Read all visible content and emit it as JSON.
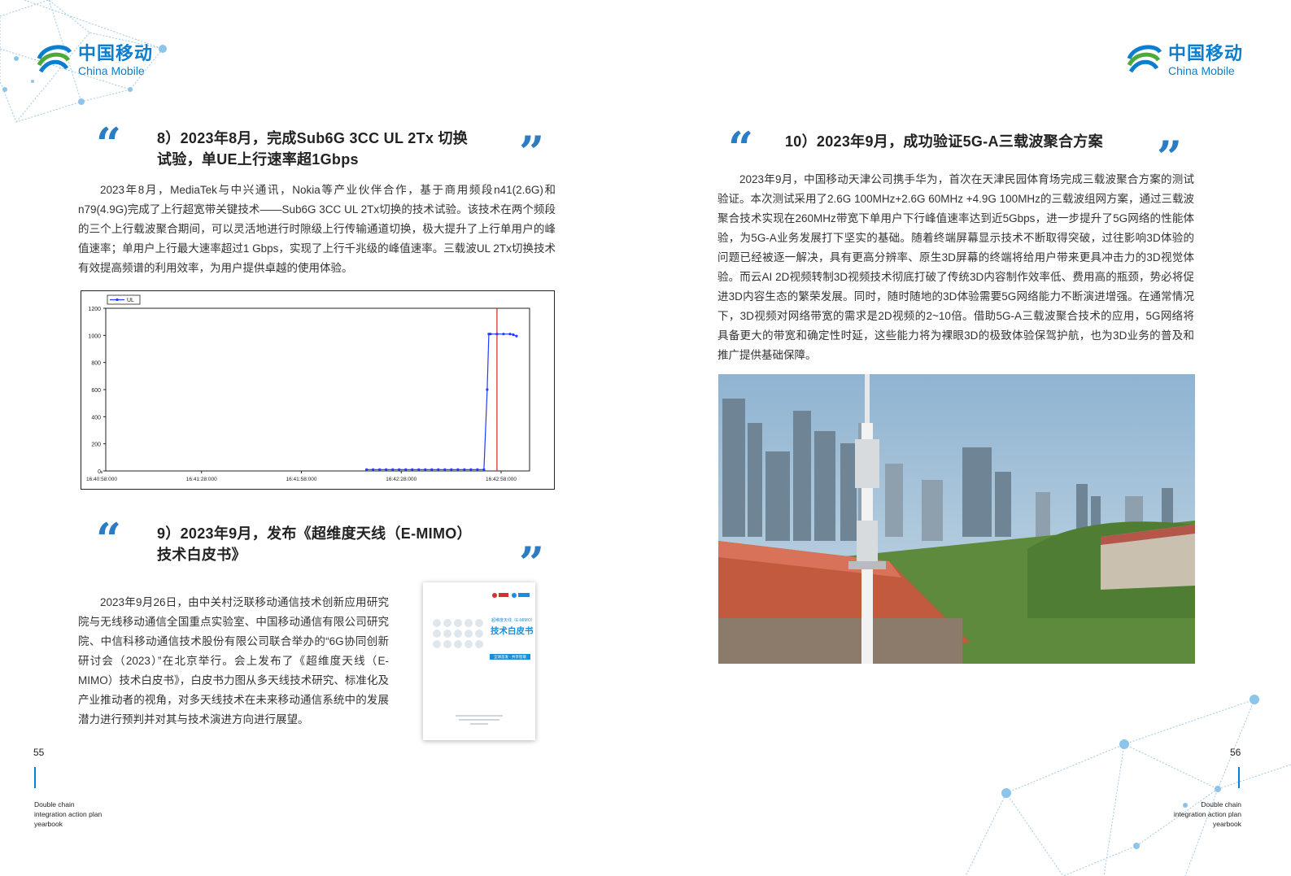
{
  "brand": {
    "name_cn": "中国移动",
    "name_en": "China Mobile"
  },
  "left": {
    "section8": {
      "quote_open": "“",
      "quote_close": "”",
      "title_line1": "8）2023年8月，完成Sub6G 3CC UL 2Tx 切换",
      "title_line2": "试验，单UE上行速率超1Gbps",
      "body": "2023年8月，MediaTek与中兴通讯，Nokia等产业伙伴合作，基于商用频段n41(2.6G)和n79(4.9G)完成了上行超宽带关键技术——Sub6G 3CC UL 2Tx切换的技术试验。该技术在两个频段的三个上行载波聚合期间，可以灵活地进行时隙级上行传输通道切换，极大提升了上行单用户的峰值速率；单用户上行最大速率超过1 Gbps，实现了上行千兆级的峰值速率。三载波UL 2Tx切换技术有效提高频谱的利用效率，为用户提供卓越的使用体验。"
    },
    "section9": {
      "quote_open": "“",
      "quote_close": "”",
      "title_line1": "9）2023年9月，发布《超维度天线（E-MIMO）",
      "title_line2": "技术白皮书》",
      "body": "2023年9月26日，由中关村泛联移动通信技术创新应用研究院与无线移动通信全国重点实验室、中国移动通信有限公司研究院、中信科移动通信技术股份有限公司联合举办的“6G协同创新研讨会（2023）”在北京举行。会上发布了《超维度天线（E-MIMO）技术白皮书》，白皮书力图从多天线技术研究、标准化及产业推动者的视角，对多天线技术在未来移动通信系统中的发展潜力进行预判并对其与技术演进方向进行展望。"
    },
    "cover": {
      "title_small": "超维度天线（E-MIMO）",
      "title_big": "技术白皮书",
      "badge": "全球首发 · 共享智联"
    },
    "page_number": "55",
    "footer": [
      "Double chain",
      "integration action plan",
      "yearbook"
    ]
  },
  "right": {
    "section10": {
      "quote_open": "“",
      "quote_close": "”",
      "title": "10）2023年9月，成功验证5G-A三载波聚合方案",
      "body": "2023年9月，中国移动天津公司携手华为，首次在天津民园体育场完成三载波聚合方案的测试验证。本次测试采用了2.6G 100MHz+2.6G 60MHz +4.9G 100MHz的三载波组网方案，通过三载波聚合技术实现在260MHz带宽下单用户下行峰值速率达到近5Gbps，进一步提升了5G网络的性能体验，为5G-A业务发展打下坚实的基础。随着终端屏幕显示技术不断取得突破，过往影响3D体验的问题已经被逐一解决，具有更高分辨率、原生3D屏幕的终端将给用户带来更具冲击力的3D视觉体验。而云AI 2D视频转制3D视频技术彻底打破了传统3D内容制作效率低、费用高的瓶颈，势必将促进3D内容生态的繁荣发展。同时，随时随地的3D体验需要5G网络能力不断演进增强。在通常情况下，3D视频对网络带宽的需求是2D视频的2~10倍。借助5G-A三载波聚合技术的应用，5G网络将具备更大的带宽和确定性时延，这些能力将为裸眼3D的极致体验保驾护航，也为3D业务的普及和推广提供基础保障。"
    },
    "page_number": "56",
    "footer": [
      "Double chain",
      "integration action plan",
      "yearbook"
    ]
  },
  "chart_data": {
    "type": "line",
    "title": "",
    "legend": [
      "UL"
    ],
    "legend_position": "top-left",
    "ylim": [
      0,
      1200
    ],
    "yticks": [
      "0",
      "200",
      "400",
      "600",
      "800",
      "1000",
      "1200"
    ],
    "xticks": [
      "16:40:58:000",
      "16:41:28:000",
      "16:41:58:000",
      "16:42:28:000",
      "16:42:58:000"
    ],
    "xlim": [
      0,
      130
    ],
    "series": [
      {
        "name": "UL",
        "x": [
          80,
          82,
          84,
          86,
          88,
          90,
          92,
          94,
          96,
          98,
          100,
          102,
          104,
          106,
          108,
          110,
          112,
          114,
          116,
          117,
          117.5,
          118,
          120,
          122,
          124,
          125,
          126
        ],
        "y": [
          10,
          10,
          10,
          10,
          10,
          10,
          10,
          10,
          10,
          10,
          10,
          10,
          10,
          10,
          10,
          10,
          10,
          10,
          10,
          600,
          1010,
          1010,
          1010,
          1010,
          1010,
          1005,
          995
        ]
      }
    ],
    "marker_line_x": 120,
    "grid": false,
    "colors": {
      "series": "#1f3cff",
      "marker_line": "#d62020"
    }
  }
}
